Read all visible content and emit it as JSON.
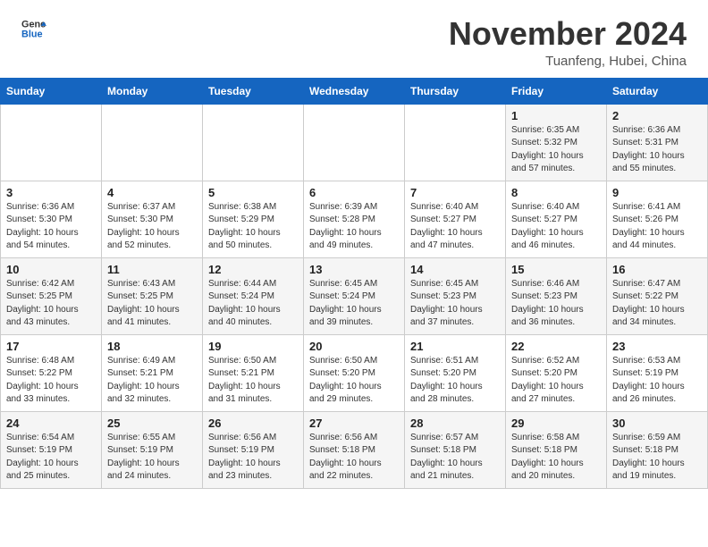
{
  "header": {
    "logo_general": "General",
    "logo_blue": "Blue",
    "month": "November 2024",
    "location": "Tuanfeng, Hubei, China"
  },
  "weekdays": [
    "Sunday",
    "Monday",
    "Tuesday",
    "Wednesday",
    "Thursday",
    "Friday",
    "Saturday"
  ],
  "weeks": [
    [
      {
        "day": "",
        "info": ""
      },
      {
        "day": "",
        "info": ""
      },
      {
        "day": "",
        "info": ""
      },
      {
        "day": "",
        "info": ""
      },
      {
        "day": "",
        "info": ""
      },
      {
        "day": "1",
        "info": "Sunrise: 6:35 AM\nSunset: 5:32 PM\nDaylight: 10 hours and 57 minutes."
      },
      {
        "day": "2",
        "info": "Sunrise: 6:36 AM\nSunset: 5:31 PM\nDaylight: 10 hours and 55 minutes."
      }
    ],
    [
      {
        "day": "3",
        "info": "Sunrise: 6:36 AM\nSunset: 5:30 PM\nDaylight: 10 hours and 54 minutes."
      },
      {
        "day": "4",
        "info": "Sunrise: 6:37 AM\nSunset: 5:30 PM\nDaylight: 10 hours and 52 minutes."
      },
      {
        "day": "5",
        "info": "Sunrise: 6:38 AM\nSunset: 5:29 PM\nDaylight: 10 hours and 50 minutes."
      },
      {
        "day": "6",
        "info": "Sunrise: 6:39 AM\nSunset: 5:28 PM\nDaylight: 10 hours and 49 minutes."
      },
      {
        "day": "7",
        "info": "Sunrise: 6:40 AM\nSunset: 5:27 PM\nDaylight: 10 hours and 47 minutes."
      },
      {
        "day": "8",
        "info": "Sunrise: 6:40 AM\nSunset: 5:27 PM\nDaylight: 10 hours and 46 minutes."
      },
      {
        "day": "9",
        "info": "Sunrise: 6:41 AM\nSunset: 5:26 PM\nDaylight: 10 hours and 44 minutes."
      }
    ],
    [
      {
        "day": "10",
        "info": "Sunrise: 6:42 AM\nSunset: 5:25 PM\nDaylight: 10 hours and 43 minutes."
      },
      {
        "day": "11",
        "info": "Sunrise: 6:43 AM\nSunset: 5:25 PM\nDaylight: 10 hours and 41 minutes."
      },
      {
        "day": "12",
        "info": "Sunrise: 6:44 AM\nSunset: 5:24 PM\nDaylight: 10 hours and 40 minutes."
      },
      {
        "day": "13",
        "info": "Sunrise: 6:45 AM\nSunset: 5:24 PM\nDaylight: 10 hours and 39 minutes."
      },
      {
        "day": "14",
        "info": "Sunrise: 6:45 AM\nSunset: 5:23 PM\nDaylight: 10 hours and 37 minutes."
      },
      {
        "day": "15",
        "info": "Sunrise: 6:46 AM\nSunset: 5:23 PM\nDaylight: 10 hours and 36 minutes."
      },
      {
        "day": "16",
        "info": "Sunrise: 6:47 AM\nSunset: 5:22 PM\nDaylight: 10 hours and 34 minutes."
      }
    ],
    [
      {
        "day": "17",
        "info": "Sunrise: 6:48 AM\nSunset: 5:22 PM\nDaylight: 10 hours and 33 minutes."
      },
      {
        "day": "18",
        "info": "Sunrise: 6:49 AM\nSunset: 5:21 PM\nDaylight: 10 hours and 32 minutes."
      },
      {
        "day": "19",
        "info": "Sunrise: 6:50 AM\nSunset: 5:21 PM\nDaylight: 10 hours and 31 minutes."
      },
      {
        "day": "20",
        "info": "Sunrise: 6:50 AM\nSunset: 5:20 PM\nDaylight: 10 hours and 29 minutes."
      },
      {
        "day": "21",
        "info": "Sunrise: 6:51 AM\nSunset: 5:20 PM\nDaylight: 10 hours and 28 minutes."
      },
      {
        "day": "22",
        "info": "Sunrise: 6:52 AM\nSunset: 5:20 PM\nDaylight: 10 hours and 27 minutes."
      },
      {
        "day": "23",
        "info": "Sunrise: 6:53 AM\nSunset: 5:19 PM\nDaylight: 10 hours and 26 minutes."
      }
    ],
    [
      {
        "day": "24",
        "info": "Sunrise: 6:54 AM\nSunset: 5:19 PM\nDaylight: 10 hours and 25 minutes."
      },
      {
        "day": "25",
        "info": "Sunrise: 6:55 AM\nSunset: 5:19 PM\nDaylight: 10 hours and 24 minutes."
      },
      {
        "day": "26",
        "info": "Sunrise: 6:56 AM\nSunset: 5:19 PM\nDaylight: 10 hours and 23 minutes."
      },
      {
        "day": "27",
        "info": "Sunrise: 6:56 AM\nSunset: 5:18 PM\nDaylight: 10 hours and 22 minutes."
      },
      {
        "day": "28",
        "info": "Sunrise: 6:57 AM\nSunset: 5:18 PM\nDaylight: 10 hours and 21 minutes."
      },
      {
        "day": "29",
        "info": "Sunrise: 6:58 AM\nSunset: 5:18 PM\nDaylight: 10 hours and 20 minutes."
      },
      {
        "day": "30",
        "info": "Sunrise: 6:59 AM\nSunset: 5:18 PM\nDaylight: 10 hours and 19 minutes."
      }
    ]
  ]
}
